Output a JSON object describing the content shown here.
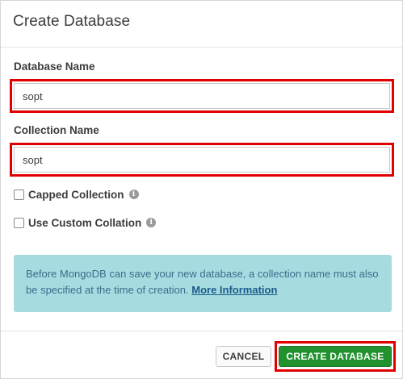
{
  "dialog": {
    "title": "Create Database"
  },
  "form": {
    "database_name": {
      "label": "Database Name",
      "value": "sopt"
    },
    "collection_name": {
      "label": "Collection Name",
      "value": "sopt"
    },
    "capped_collection": {
      "label": "Capped Collection",
      "checked": false,
      "icon": "info-icon"
    },
    "custom_collation": {
      "label": "Use Custom Collation",
      "checked": false,
      "icon": "info-icon"
    }
  },
  "info": {
    "text": "Before MongoDB can save your new database, a collection name must also be specified at the time of creation.",
    "link_text": "More Information"
  },
  "footer": {
    "cancel_label": "CANCEL",
    "create_label": "CREATE DATABASE"
  },
  "colors": {
    "highlight_border": "#e00000",
    "create_button_bg": "#22922f",
    "info_box_bg": "#a6dce0",
    "info_text": "#3a6d8c"
  }
}
